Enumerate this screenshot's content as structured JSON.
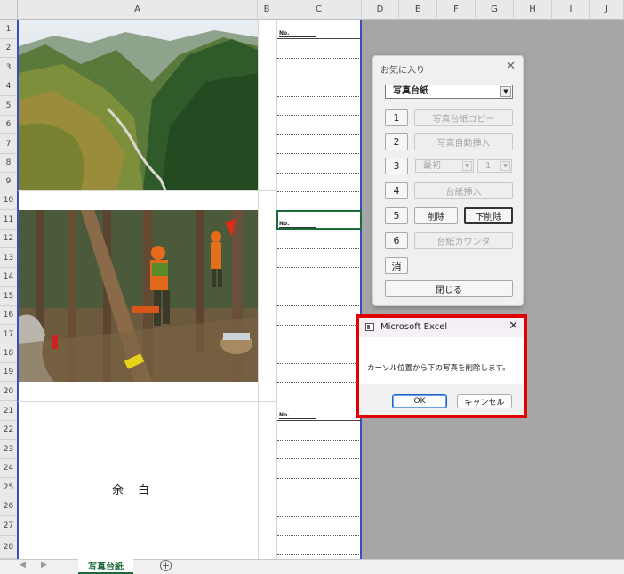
{
  "columns": [
    "A",
    "B",
    "C",
    "D",
    "E",
    "F",
    "G",
    "H",
    "I",
    "J"
  ],
  "rows": [
    "1",
    "2",
    "3",
    "4",
    "5",
    "6",
    "7",
    "8",
    "9",
    "10",
    "11",
    "12",
    "13",
    "14",
    "15",
    "16",
    "17",
    "18",
    "19",
    "20",
    "21",
    "22",
    "23",
    "24",
    "25",
    "26",
    "27",
    "28"
  ],
  "sheet": {
    "no_label": "No.",
    "yohaku": "余白"
  },
  "tabs": {
    "active": "写真台紙",
    "prev_icon": "◀",
    "next_icon": "▶",
    "add_icon": "+"
  },
  "form": {
    "title": "お気に入り",
    "close": "✕",
    "combo_value": "写真台紙",
    "combo_arrow": "▼",
    "num1": "1",
    "num2": "2",
    "num3": "3",
    "num4": "4",
    "num5": "5",
    "num6": "6",
    "copy_button": "写真台紙コピー",
    "auto_insert_button": "写真自動挿入",
    "first_dropdown": "最初",
    "count_dropdown": "1",
    "insert_button": "台紙挿入",
    "delete_button": "削除",
    "delete_below_button": "下削除",
    "counter_button": "台紙カウンタ",
    "clear_button": "消",
    "close_button": "閉じる"
  },
  "messagebox": {
    "title": "Microsoft Excel",
    "close": "✕",
    "text": "カーソル位置から下の写真を削除します。",
    "ok": "OK",
    "cancel": "キャンセル",
    "highlight_color": "#e00000"
  }
}
